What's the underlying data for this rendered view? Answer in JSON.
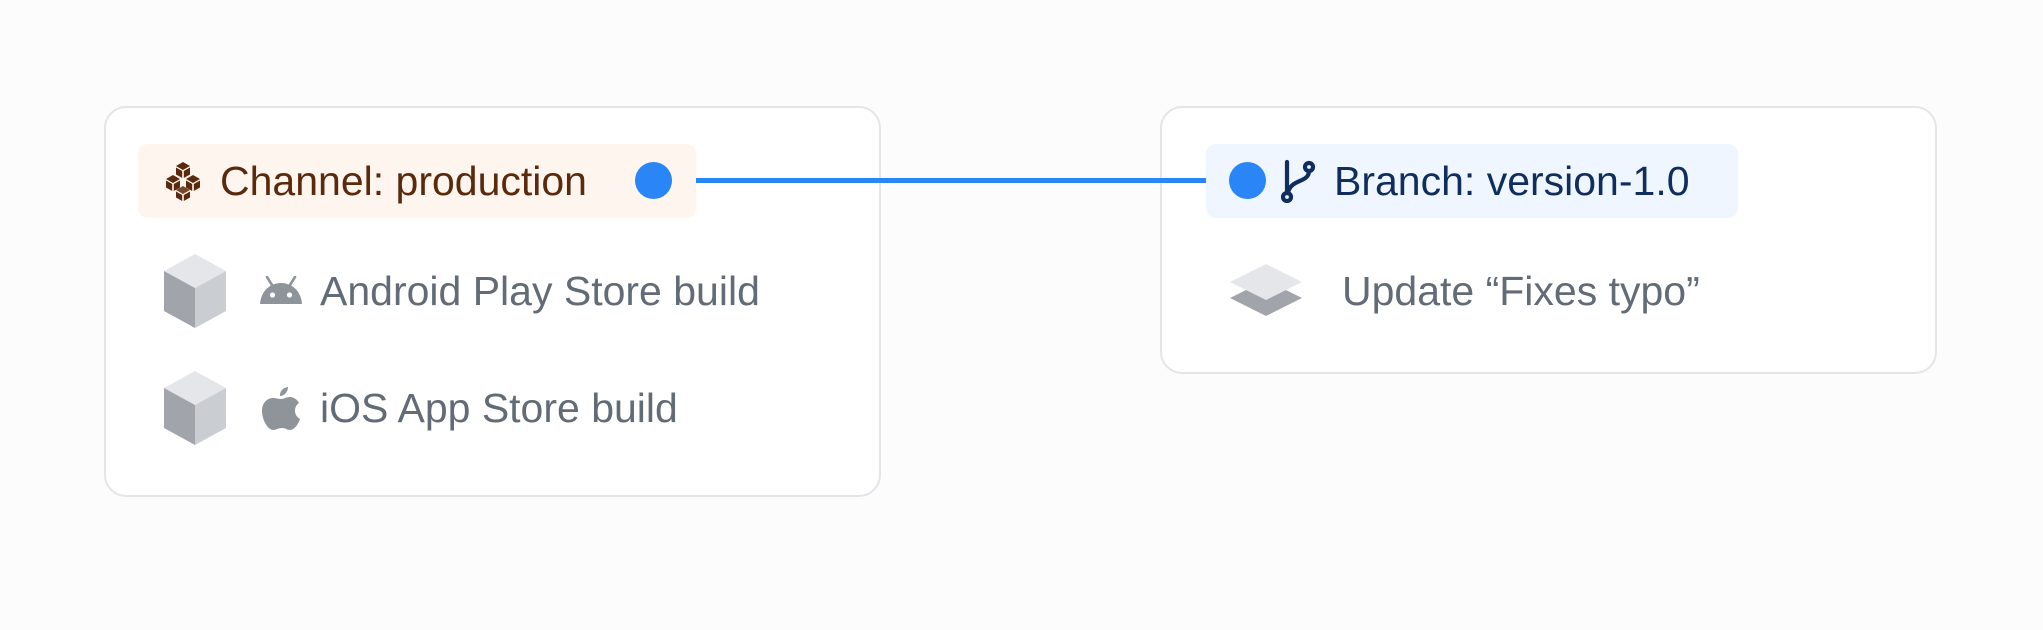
{
  "channel": {
    "label": "Channel: production",
    "icon": "stacked-boxes-icon",
    "builds": [
      {
        "label": "Android Play Store build",
        "platform_icon": "android-icon",
        "build_icon": "cube-icon"
      },
      {
        "label": "iOS App Store build",
        "platform_icon": "apple-icon",
        "build_icon": "cube-icon"
      }
    ]
  },
  "branch": {
    "label": "Branch: version-1.0",
    "icon": "git-branch-icon",
    "updates": [
      {
        "label": "Update “Fixes typo”",
        "icon": "layers-icon"
      }
    ]
  },
  "colors": {
    "connector": "#2a86f7",
    "channel_pill_bg": "#fff5ef",
    "channel_text": "#5a2a0c",
    "branch_pill_bg": "#eff6ff",
    "branch_text": "#0f2e5e",
    "row_text": "#636b76"
  }
}
